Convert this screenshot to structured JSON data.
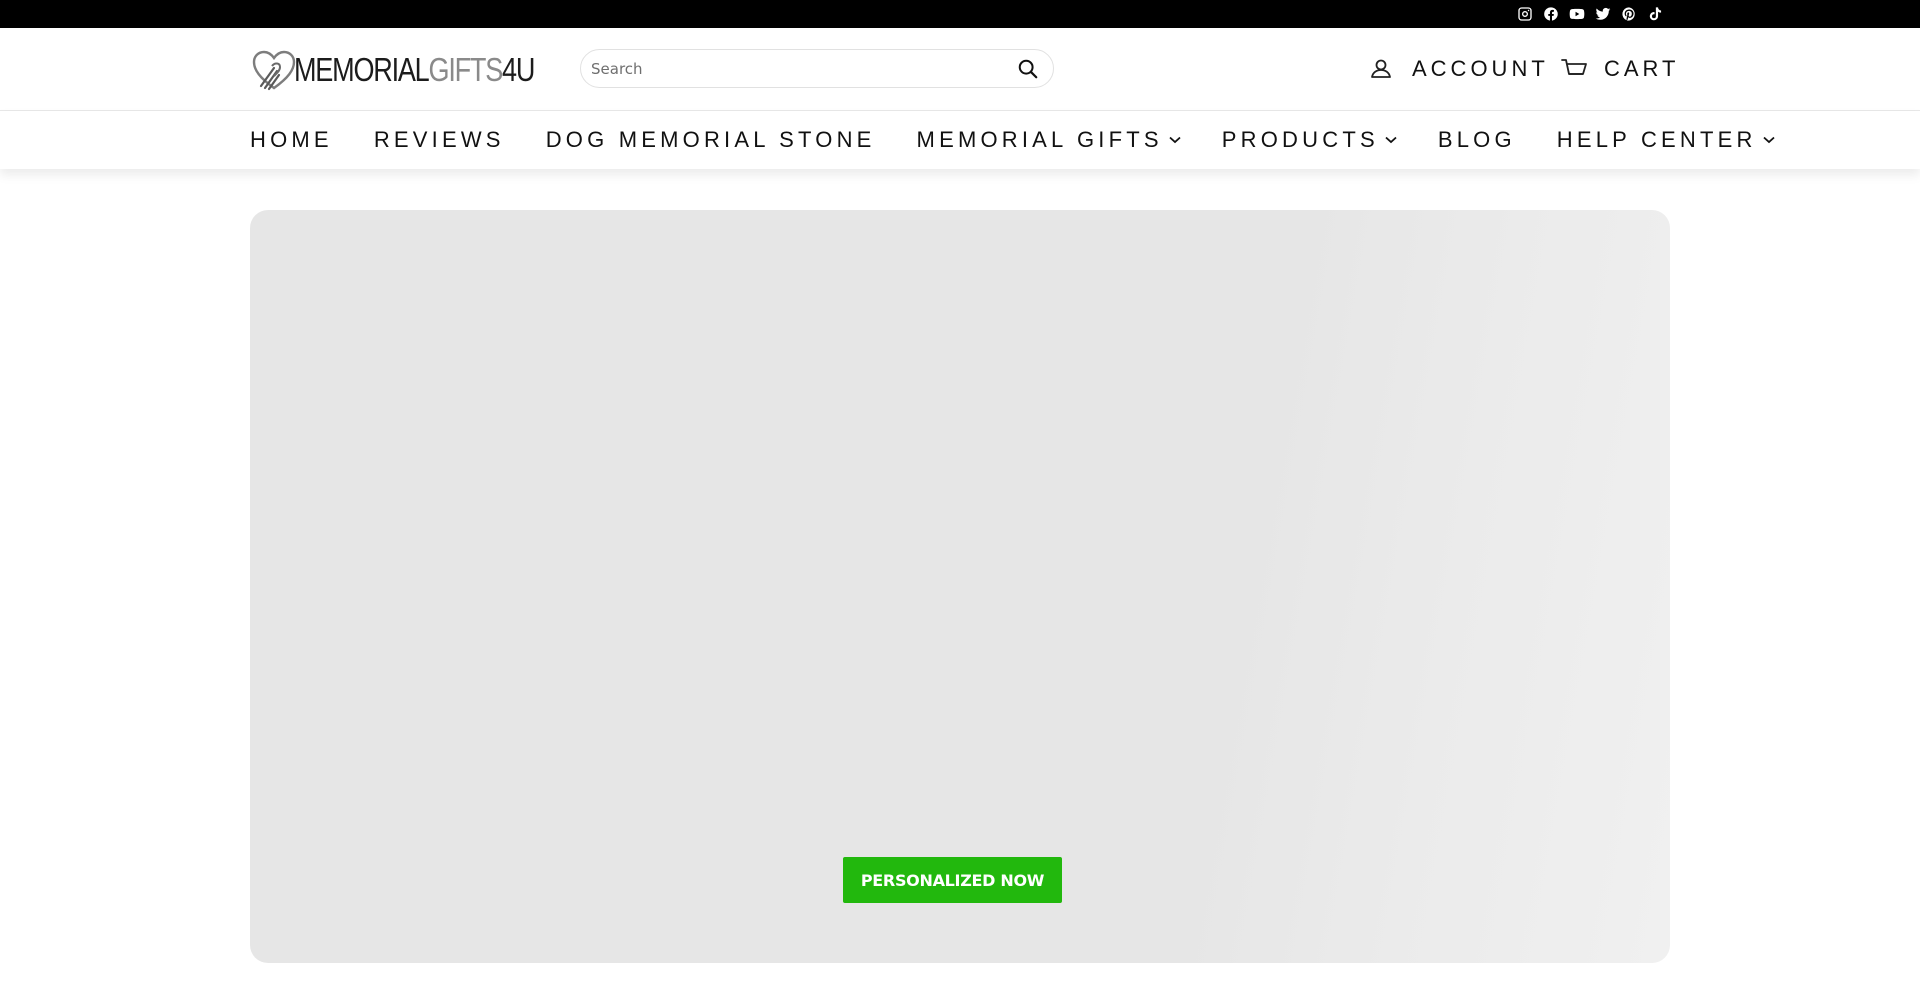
{
  "social": {
    "icons": [
      "instagram-icon",
      "facebook-icon",
      "youtube-icon",
      "twitter-icon",
      "pinterest-icon",
      "tiktok-icon"
    ],
    "color": "#ffffff",
    "background": "#000000"
  },
  "header": {
    "logo": {
      "part1": "MEMORIAL",
      "part2": "GIFTS",
      "part3": "4U",
      "icon": "heart-paw-icon"
    },
    "search": {
      "placeholder": "Search",
      "value": "",
      "icon": "search-icon"
    },
    "account_label": "ACCOUNT",
    "account_icon": "user-icon",
    "cart_label": "CART",
    "cart_icon": "cart-icon"
  },
  "nav": {
    "items": [
      {
        "label": "HOME",
        "has_dropdown": false
      },
      {
        "label": "REVIEWS",
        "has_dropdown": false
      },
      {
        "label": "DOG MEMORIAL STONE",
        "has_dropdown": false
      },
      {
        "label": "MEMORIAL GIFTS",
        "has_dropdown": true
      },
      {
        "label": "PRODUCTS",
        "has_dropdown": true
      },
      {
        "label": "BLOG",
        "has_dropdown": false
      },
      {
        "label": "HELP CENTER",
        "has_dropdown": true
      }
    ]
  },
  "hero": {
    "cta_label": "PERSONALIZED NOW",
    "cta_color": "#22b80d",
    "background": "#e6e6e6"
  }
}
